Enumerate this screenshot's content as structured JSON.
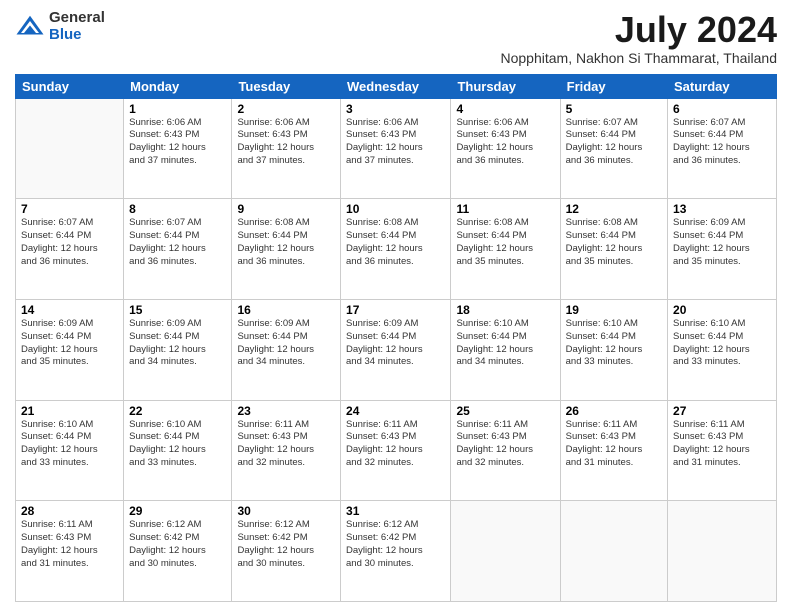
{
  "logo": {
    "general": "General",
    "blue": "Blue"
  },
  "title": "July 2024",
  "subtitle": "Nopphitam, Nakhon Si Thammarat, Thailand",
  "weekdays": [
    "Sunday",
    "Monday",
    "Tuesday",
    "Wednesday",
    "Thursday",
    "Friday",
    "Saturday"
  ],
  "weeks": [
    [
      {
        "day": "",
        "info": ""
      },
      {
        "day": "1",
        "info": "Sunrise: 6:06 AM\nSunset: 6:43 PM\nDaylight: 12 hours\nand 37 minutes."
      },
      {
        "day": "2",
        "info": "Sunrise: 6:06 AM\nSunset: 6:43 PM\nDaylight: 12 hours\nand 37 minutes."
      },
      {
        "day": "3",
        "info": "Sunrise: 6:06 AM\nSunset: 6:43 PM\nDaylight: 12 hours\nand 37 minutes."
      },
      {
        "day": "4",
        "info": "Sunrise: 6:06 AM\nSunset: 6:43 PM\nDaylight: 12 hours\nand 36 minutes."
      },
      {
        "day": "5",
        "info": "Sunrise: 6:07 AM\nSunset: 6:44 PM\nDaylight: 12 hours\nand 36 minutes."
      },
      {
        "day": "6",
        "info": "Sunrise: 6:07 AM\nSunset: 6:44 PM\nDaylight: 12 hours\nand 36 minutes."
      }
    ],
    [
      {
        "day": "7",
        "info": ""
      },
      {
        "day": "8",
        "info": "Sunrise: 6:07 AM\nSunset: 6:44 PM\nDaylight: 12 hours\nand 36 minutes."
      },
      {
        "day": "9",
        "info": "Sunrise: 6:08 AM\nSunset: 6:44 PM\nDaylight: 12 hours\nand 36 minutes."
      },
      {
        "day": "10",
        "info": "Sunrise: 6:08 AM\nSunset: 6:44 PM\nDaylight: 12 hours\nand 36 minutes."
      },
      {
        "day": "11",
        "info": "Sunrise: 6:08 AM\nSunset: 6:44 PM\nDaylight: 12 hours\nand 35 minutes."
      },
      {
        "day": "12",
        "info": "Sunrise: 6:08 AM\nSunset: 6:44 PM\nDaylight: 12 hours\nand 35 minutes."
      },
      {
        "day": "13",
        "info": "Sunrise: 6:09 AM\nSunset: 6:44 PM\nDaylight: 12 hours\nand 35 minutes."
      }
    ],
    [
      {
        "day": "14",
        "info": ""
      },
      {
        "day": "15",
        "info": "Sunrise: 6:09 AM\nSunset: 6:44 PM\nDaylight: 12 hours\nand 34 minutes."
      },
      {
        "day": "16",
        "info": "Sunrise: 6:09 AM\nSunset: 6:44 PM\nDaylight: 12 hours\nand 34 minutes."
      },
      {
        "day": "17",
        "info": "Sunrise: 6:09 AM\nSunset: 6:44 PM\nDaylight: 12 hours\nand 34 minutes."
      },
      {
        "day": "18",
        "info": "Sunrise: 6:10 AM\nSunset: 6:44 PM\nDaylight: 12 hours\nand 34 minutes."
      },
      {
        "day": "19",
        "info": "Sunrise: 6:10 AM\nSunset: 6:44 PM\nDaylight: 12 hours\nand 33 minutes."
      },
      {
        "day": "20",
        "info": "Sunrise: 6:10 AM\nSunset: 6:44 PM\nDaylight: 12 hours\nand 33 minutes."
      }
    ],
    [
      {
        "day": "21",
        "info": ""
      },
      {
        "day": "22",
        "info": "Sunrise: 6:10 AM\nSunset: 6:44 PM\nDaylight: 12 hours\nand 33 minutes."
      },
      {
        "day": "23",
        "info": "Sunrise: 6:11 AM\nSunset: 6:43 PM\nDaylight: 12 hours\nand 32 minutes."
      },
      {
        "day": "24",
        "info": "Sunrise: 6:11 AM\nSunset: 6:43 PM\nDaylight: 12 hours\nand 32 minutes."
      },
      {
        "day": "25",
        "info": "Sunrise: 6:11 AM\nSunset: 6:43 PM\nDaylight: 12 hours\nand 32 minutes."
      },
      {
        "day": "26",
        "info": "Sunrise: 6:11 AM\nSunset: 6:43 PM\nDaylight: 12 hours\nand 31 minutes."
      },
      {
        "day": "27",
        "info": "Sunrise: 6:11 AM\nSunset: 6:43 PM\nDaylight: 12 hours\nand 31 minutes."
      }
    ],
    [
      {
        "day": "28",
        "info": "Sunrise: 6:11 AM\nSunset: 6:43 PM\nDaylight: 12 hours\nand 31 minutes."
      },
      {
        "day": "29",
        "info": "Sunrise: 6:12 AM\nSunset: 6:42 PM\nDaylight: 12 hours\nand 30 minutes."
      },
      {
        "day": "30",
        "info": "Sunrise: 6:12 AM\nSunset: 6:42 PM\nDaylight: 12 hours\nand 30 minutes."
      },
      {
        "day": "31",
        "info": "Sunrise: 6:12 AM\nSunset: 6:42 PM\nDaylight: 12 hours\nand 30 minutes."
      },
      {
        "day": "",
        "info": ""
      },
      {
        "day": "",
        "info": ""
      },
      {
        "day": "",
        "info": ""
      }
    ]
  ],
  "week1_sun_info": "Sunrise: 6:07 AM\nSunset: 6:44 PM\nDaylight: 12 hours\nand 36 minutes.",
  "week3_sun_info": "Sunrise: 6:09 AM\nSunset: 6:44 PM\nDaylight: 12 hours\nand 35 minutes.",
  "week4_sun_info": "Sunrise: 6:10 AM\nSunset: 6:44 PM\nDaylight: 12 hours\nand 34 minutes.",
  "week5_sun_info": "Sunrise: 6:10 AM\nSunset: 6:44 PM\nDaylight: 12 hours\nand 33 minutes."
}
